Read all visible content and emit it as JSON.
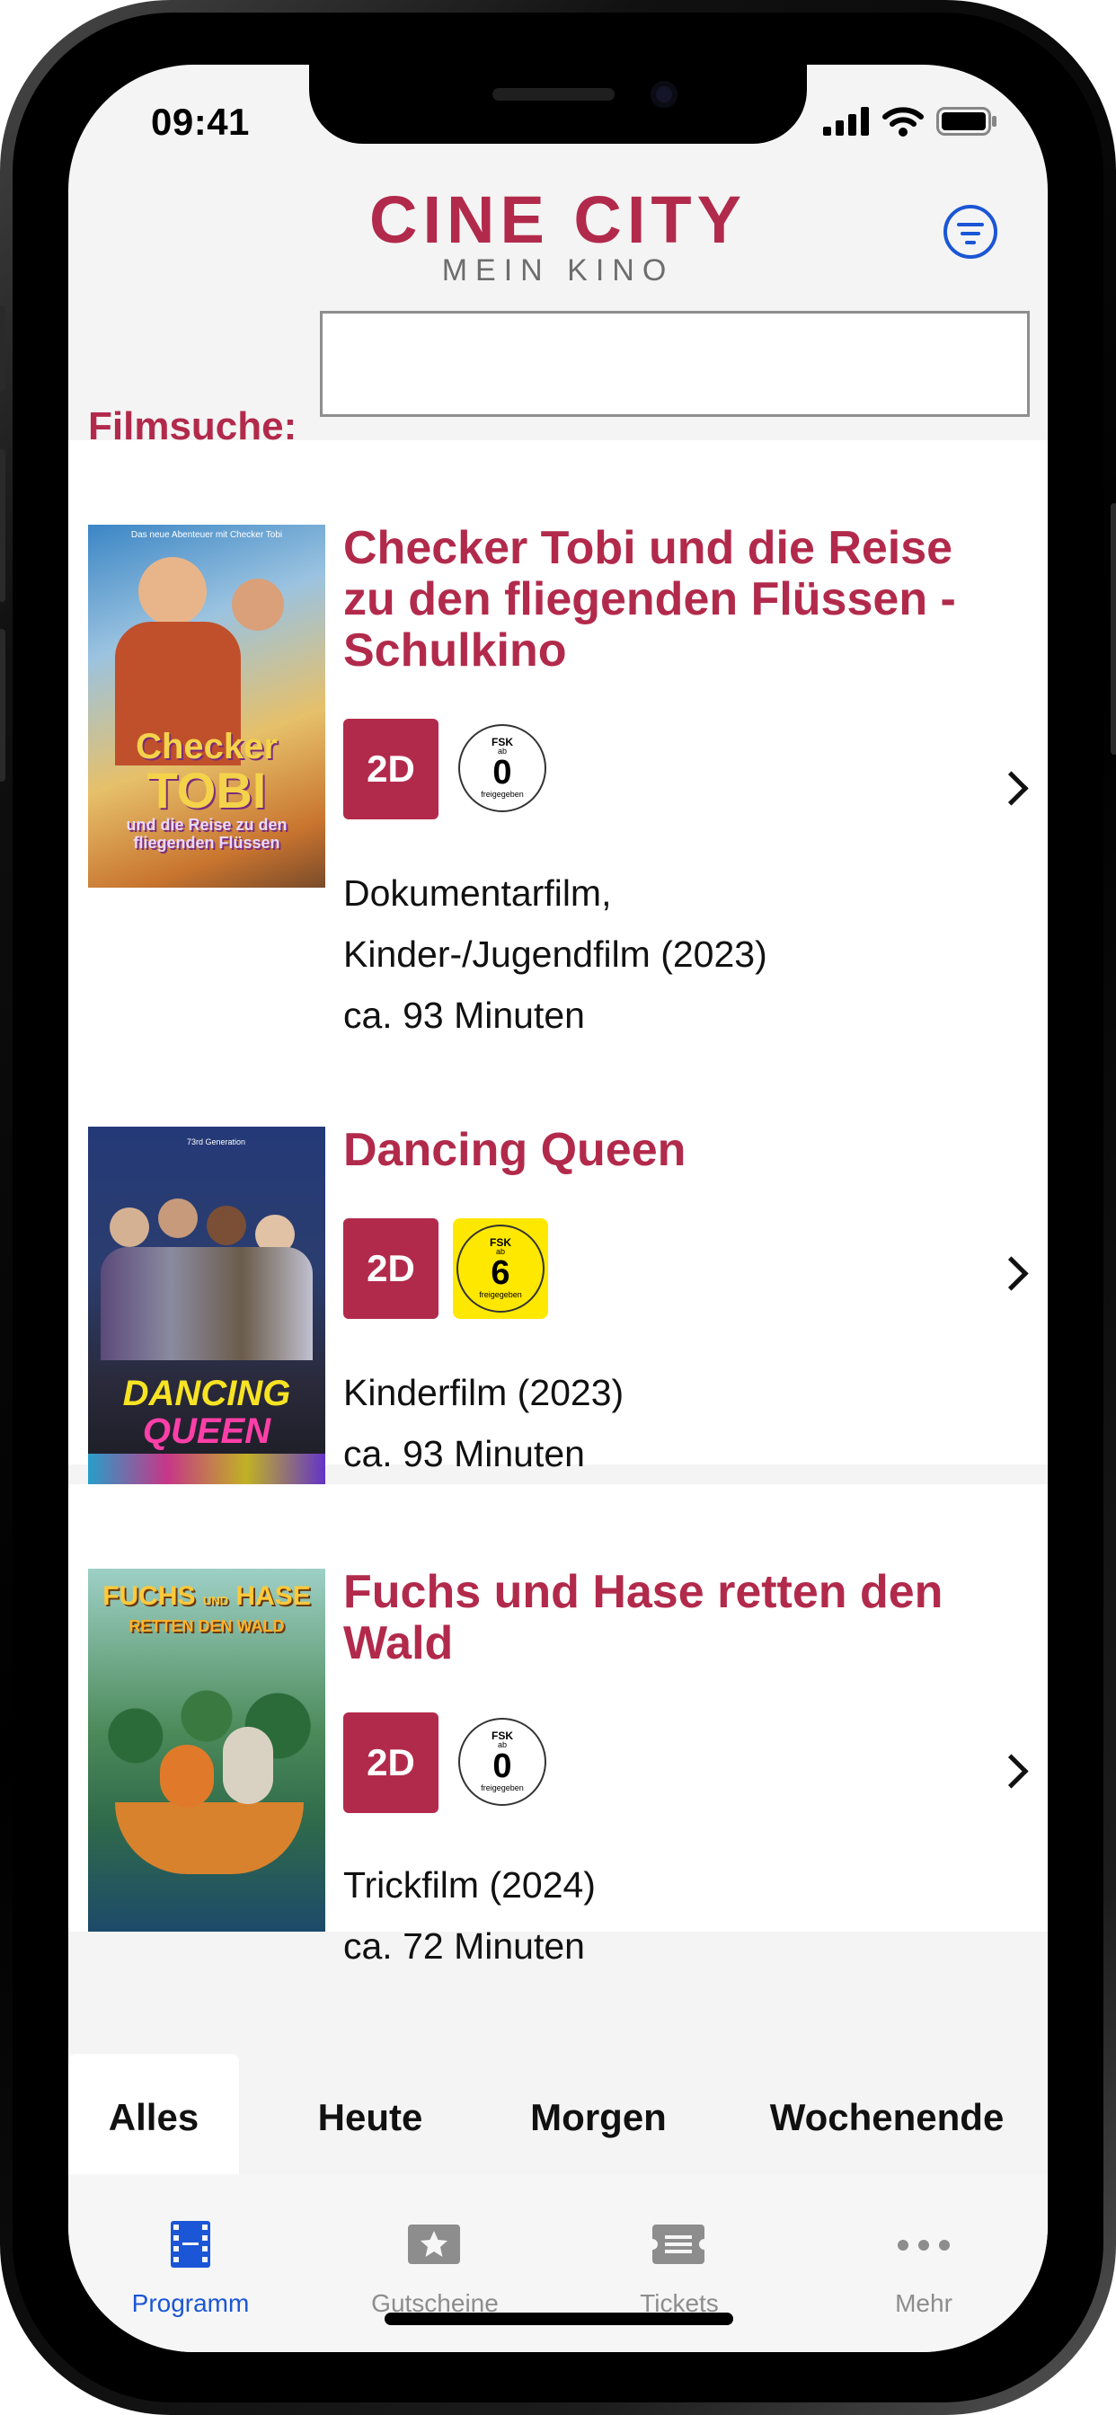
{
  "status_bar": {
    "time": "09:41"
  },
  "header": {
    "logo_main": "CINE CITY",
    "logo_sub": "MEIN KINO",
    "menu_icon": "filter-list-icon"
  },
  "search": {
    "label": "Filmsuche:",
    "value": "",
    "placeholder": ""
  },
  "films": [
    {
      "title": "Checker Tobi und die Reise zu den fliegenden Flüssen - Schulkino",
      "format": "2D",
      "fsk": {
        "line1": "FSK",
        "line2": "ab",
        "age": "0",
        "line4": "freigegeben"
      },
      "genre": "Dokumentarfilm, Kinder-/Jugendfilm (2023)",
      "duration": "ca. 93 Minuten",
      "poster": {
        "tagline": "Das neue Abenteuer mit Checker Tobi",
        "title_line1": "Checker",
        "title_line2": "TOBI",
        "title_line3": "und die Reise zu den",
        "title_line4": "fliegenden Flüssen"
      }
    },
    {
      "title": "Dancing Queen",
      "format": "2D",
      "fsk": {
        "line1": "FSK",
        "line2": "ab",
        "age": "6",
        "line4": "freigegeben"
      },
      "genre": "Kinderfilm (2023)",
      "duration": "ca. 93 Minuten",
      "poster": {
        "festival": "73rd Generation",
        "title_line1": "DANCING",
        "title_line2": "QUEEN"
      }
    },
    {
      "title": "Fuchs und Hase retten den Wald",
      "format": "2D",
      "fsk": {
        "line1": "FSK",
        "line2": "ab",
        "age": "0",
        "line4": "freigegeben"
      },
      "genre": "Trickfilm (2024)",
      "duration": "ca. 72 Minuten",
      "poster": {
        "title_line1": "FUCHS",
        "title_and": "UND",
        "title_line1b": "HASE",
        "title_line2": "RETTEN DEN WALD"
      }
    }
  ],
  "date_filter": {
    "tabs": [
      {
        "label": "Alles",
        "active": true
      },
      {
        "label": "Heute",
        "active": false
      },
      {
        "label": "Morgen",
        "active": false
      },
      {
        "label": "Wochenende",
        "active": false
      }
    ]
  },
  "tab_bar": {
    "items": [
      {
        "label": "Programm",
        "icon": "film-strip-icon",
        "active": true
      },
      {
        "label": "Gutscheine",
        "icon": "voucher-star-icon",
        "active": false
      },
      {
        "label": "Tickets",
        "icon": "ticket-icon",
        "active": false
      },
      {
        "label": "Mehr",
        "icon": "more-dots-icon",
        "active": false
      }
    ]
  },
  "colors": {
    "brand_red": "#b22a4b",
    "accent_blue": "#1a56d6",
    "fsk6_yellow": "#ffe800",
    "inactive_gray": "#8d8d8d"
  }
}
